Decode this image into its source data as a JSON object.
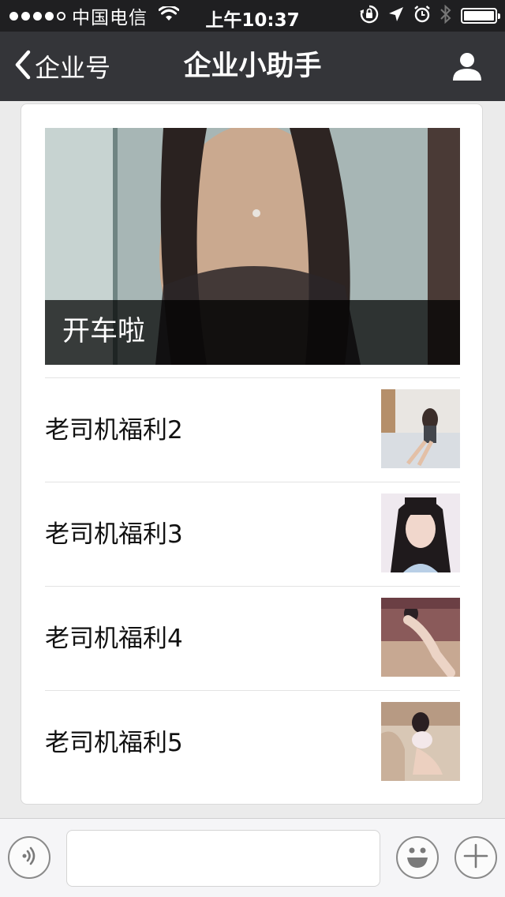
{
  "status_bar": {
    "carrier": "中国电信",
    "time": "上午10:37",
    "signal_icon": "signal-dots-icon",
    "wifi_icon": "wifi-icon",
    "rotation_lock_icon": "rotation-lock-icon",
    "location_icon": "location-arrow-icon",
    "alarm_icon": "alarm-icon",
    "bluetooth_icon": "bluetooth-icon",
    "battery_icon": "battery-icon",
    "battery_level": 0.95
  },
  "nav": {
    "back_label": "企业号",
    "title": "企业小助手",
    "back_icon": "chevron-left-icon",
    "user_icon": "user-icon"
  },
  "message": {
    "cover_title": "开车啦",
    "items": [
      {
        "title": "老司机福利2"
      },
      {
        "title": "老司机福利3"
      },
      {
        "title": "老司机福利4"
      },
      {
        "title": "老司机福利5"
      }
    ]
  },
  "input_bar": {
    "voice_icon": "voice-icon",
    "emoji_icon": "emoji-icon",
    "plus_icon": "plus-icon",
    "text_value": ""
  },
  "colors": {
    "status_bar_bg": "#1f1f21",
    "nav_bg": "#343539",
    "page_bg": "#ebebeb",
    "card_bg": "#ffffff"
  }
}
